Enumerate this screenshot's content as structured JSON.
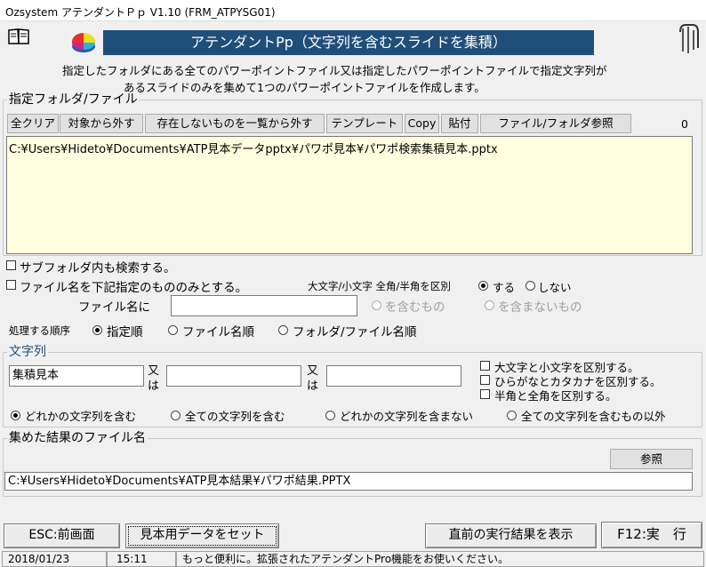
{
  "window": {
    "title": "Ozsystem アテンダントＰｐ V1.10 (FRM_ATPYSG01)"
  },
  "header": {
    "banner": "アテンダントPp（文字列を含むスライドを集積）",
    "desc_line1": "指定したフォルダにある全てのパワーポイントファイル又は指定したパワーポイントファイルで指定文字列が",
    "desc_line2": "あるスライドのみを集めて1つのパワーポイントファイルを作成します。"
  },
  "folder_group": {
    "label": "指定フォルダ/ファイル",
    "buttons": [
      "全クリア",
      "対象から外す",
      "存在しないものを一覧から外す",
      "テンプレート",
      "Copy",
      "貼付",
      "ファイル/フォルダ参照"
    ],
    "count": "0",
    "list_item": "C:¥Users¥Hideto¥Documents¥ATP見本データpptx¥パワポ見本¥パワポ検索集積見本.pptx"
  },
  "options": {
    "subfolder_label": "サブフォルダ内も検索する。",
    "filename_only_label": "ファイル名を下記指定のもののみとする。",
    "case_label": "大文字/小文字 全角/半角を区別",
    "case_yes": "する",
    "case_no": "しない",
    "filename_label": "ファイル名に",
    "filename_value": "",
    "contains_label": "を含むもの",
    "not_contains_label": "を含まないもの",
    "order_label": "処理する順序",
    "order_options": [
      "指定順",
      "ファイル名順",
      "フォルダ/ファイル名順"
    ]
  },
  "string_group": {
    "label": "文字列",
    "input1": "集積見本",
    "input2": "",
    "input3": "",
    "or_top": "又",
    "or_bottom": "は",
    "checks": [
      "大文字と小文字を区別する。",
      "ひらがなとカタカナを区別する。",
      "半角と全角を区別する。"
    ],
    "match_options": [
      "どれかの文字列を含む",
      "全ての文字列を含む",
      "どれかの文字列を含まない",
      "全ての文字列を含むもの以外"
    ]
  },
  "result_group": {
    "label": "集めた結果のファイル名",
    "browse": "参照",
    "path": "C:¥Users¥Hideto¥Documents¥ATP見本結果¥パワポ結果.PPTX"
  },
  "footer": {
    "esc": "ESC:前画面",
    "sample": "見本用データをセット",
    "show_prev": "直前の実行結果を表示",
    "run": "F12:実　行"
  },
  "statusbar": {
    "date": "2018/01/23",
    "time": "15:11",
    "message": "もっと便利に。拡張されたアテンダントPro機能をお使いください。"
  }
}
